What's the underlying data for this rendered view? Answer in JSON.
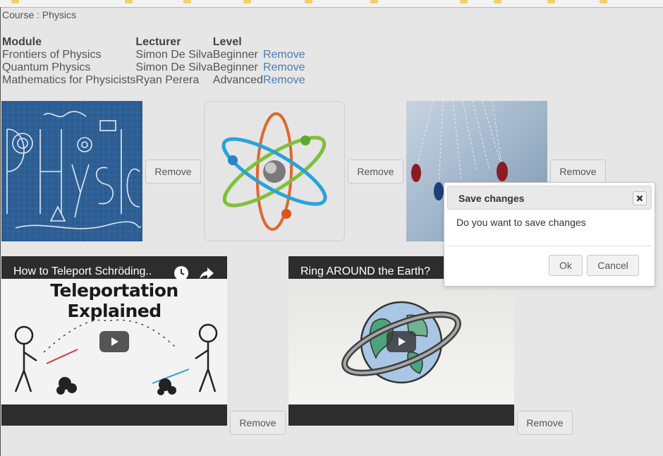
{
  "course": {
    "title": "Course : Physics"
  },
  "modules": {
    "headers": [
      "Module",
      "Lecturer",
      "Level"
    ],
    "rows": [
      {
        "module": "Frontiers of Physics",
        "lecturer": "Simon De Silva",
        "level": "Beginner",
        "action": "Remove"
      },
      {
        "module": "Quantum Physics",
        "lecturer": "Simon De Silva",
        "level": "Beginner",
        "action": "Remove"
      },
      {
        "module": "Mathematics for Physicists",
        "lecturer": "Ryan Perera",
        "level": "Advanced",
        "action": "Remove"
      }
    ]
  },
  "images": {
    "remove_label": "Remove",
    "items": [
      {
        "name": "physics-blueprint-image"
      },
      {
        "name": "atom-image"
      },
      {
        "name": "pendulum-image"
      }
    ]
  },
  "videos": {
    "remove_label": "Remove",
    "items": [
      {
        "title": "How to Teleport Schröding..",
        "banner": "Teleportation Explained"
      },
      {
        "title": "Ring AROUND the Earth?",
        "banner": ""
      }
    ]
  },
  "modal": {
    "title": "Save changes",
    "body": "Do you want to save changes",
    "ok_label": "Ok",
    "cancel_label": "Cancel"
  },
  "colors": {
    "background": "#e6e6e6",
    "link": "#4a7bb7",
    "blueprint": "#2c5d92",
    "youtube_play": "#3a3a3a"
  }
}
